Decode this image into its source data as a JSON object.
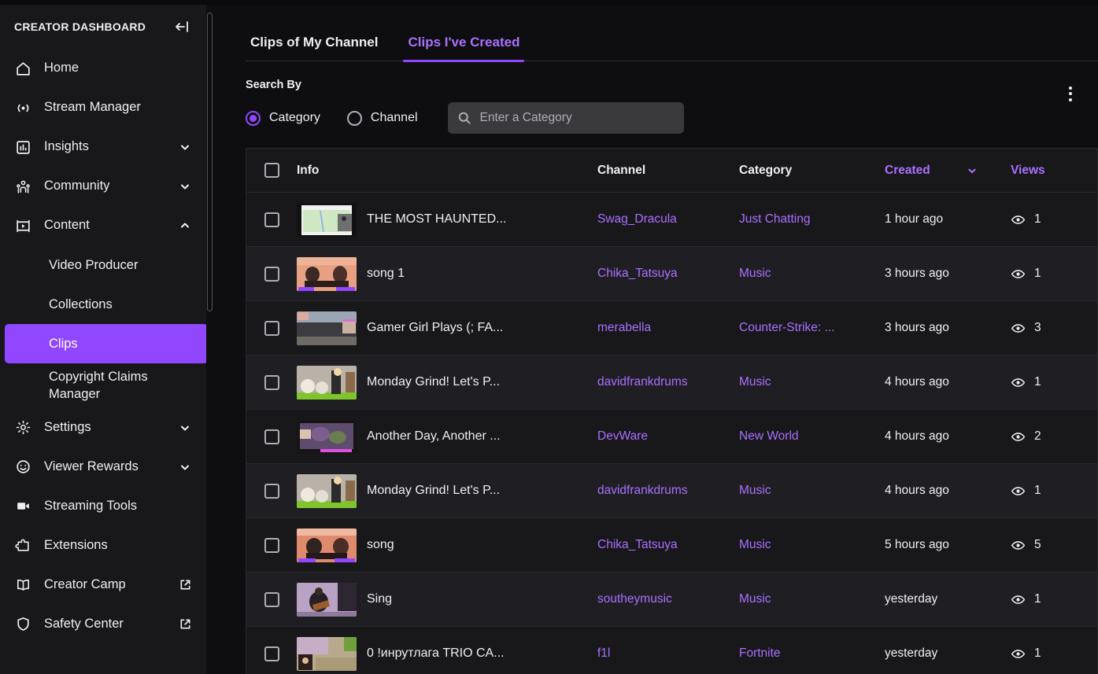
{
  "colors": {
    "accent": "#9147ff",
    "accent_text": "#a970ff",
    "sidebar_bg": "#18181b",
    "main_bg": "#0e0e10",
    "row_odd": "#18181b",
    "row_even": "#1f1f23",
    "text": "#efeff1",
    "muted": "#adadb8"
  },
  "sidebar": {
    "title": "CREATOR DASHBOARD",
    "collapse_icon": "collapse-left-arrow-icon",
    "items": [
      {
        "label": "Home",
        "icon": "home-icon",
        "chevron": null,
        "external": false
      },
      {
        "label": "Stream Manager",
        "icon": "broadcast-icon",
        "chevron": null,
        "external": false
      },
      {
        "label": "Insights",
        "icon": "bar-chart-icon",
        "chevron": "down",
        "external": false
      },
      {
        "label": "Community",
        "icon": "people-icon",
        "chevron": "down",
        "external": false
      },
      {
        "label": "Content",
        "icon": "content-frame-icon",
        "chevron": "up",
        "external": false
      }
    ],
    "content_subitems": [
      {
        "label": "Video Producer",
        "active": false
      },
      {
        "label": "Collections",
        "active": false
      },
      {
        "label": "Clips",
        "active": true
      },
      {
        "label": "Copyright Claims Manager",
        "active": false
      }
    ],
    "items_after": [
      {
        "label": "Settings",
        "icon": "gear-icon",
        "chevron": "down",
        "external": false
      },
      {
        "label": "Viewer Rewards",
        "icon": "smiley-icon",
        "chevron": "down",
        "external": false
      },
      {
        "label": "Streaming Tools",
        "icon": "video-camera-icon",
        "chevron": null,
        "external": false
      },
      {
        "label": "Extensions",
        "icon": "puzzle-icon",
        "chevron": null,
        "external": false
      },
      {
        "label": "Creator Camp",
        "icon": "book-icon",
        "chevron": null,
        "external": true
      },
      {
        "label": "Safety Center",
        "icon": "shield-icon",
        "chevron": null,
        "external": true
      }
    ]
  },
  "tabs": [
    {
      "label": "Clips of My Channel",
      "active": false
    },
    {
      "label": "Clips I've Created",
      "active": true
    }
  ],
  "search": {
    "heading": "Search By",
    "options": [
      {
        "label": "Category",
        "checked": true
      },
      {
        "label": "Channel",
        "checked": false
      }
    ],
    "placeholder": "Enter a Category",
    "value": "",
    "search_icon": "search-icon",
    "overflow_icon": "kebab-menu-icon"
  },
  "table": {
    "columns": {
      "info": "Info",
      "channel": "Channel",
      "category": "Category",
      "created": "Created",
      "views": "Views"
    },
    "sorted_by": "Created",
    "sort_direction": "down",
    "rows": [
      {
        "title": "THE MOST HAUNTED...",
        "channel": "Swag_Dracula",
        "category": "Just Chatting",
        "created": "1 hour ago",
        "views": "1",
        "thumb": "map-screenshare-thumb"
      },
      {
        "title": "song 1",
        "channel": "Chika_Tatsuya",
        "category": "Music",
        "created": "3 hours ago",
        "views": "1",
        "thumb": "two-people-pink-room-thumb"
      },
      {
        "title": "Gamer Girl Plays (; FA...",
        "channel": "merabella",
        "category": "Counter-Strike: ...",
        "created": "3 hours ago",
        "views": "3",
        "thumb": "fps-gameplay-thumb"
      },
      {
        "title": "Monday Grind! Let's P...",
        "channel": "davidfrankdrums",
        "category": "Music",
        "created": "4 hours ago",
        "views": "1",
        "thumb": "drum-kit-thumb"
      },
      {
        "title": "Another Day, Another ...",
        "channel": "DevWare",
        "category": "New World",
        "created": "4 hours ago",
        "views": "2",
        "thumb": "map-game-thumb"
      },
      {
        "title": "Monday Grind! Let's P...",
        "channel": "davidfrankdrums",
        "category": "Music",
        "created": "4 hours ago",
        "views": "1",
        "thumb": "drum-kit-thumb"
      },
      {
        "title": "song",
        "channel": "Chika_Tatsuya",
        "category": "Music",
        "created": "5 hours ago",
        "views": "5",
        "thumb": "two-people-pink-room-thumb"
      },
      {
        "title": "Sing",
        "channel": "southeymusic",
        "category": "Music",
        "created": "yesterday",
        "views": "1",
        "thumb": "guitar-player-thumb"
      },
      {
        "title": "0 !инрутлага TRIO CA...",
        "channel": "f1l",
        "category": "Fortnite",
        "created": "yesterday",
        "views": "1",
        "thumb": "fortnite-thumb"
      }
    ]
  }
}
